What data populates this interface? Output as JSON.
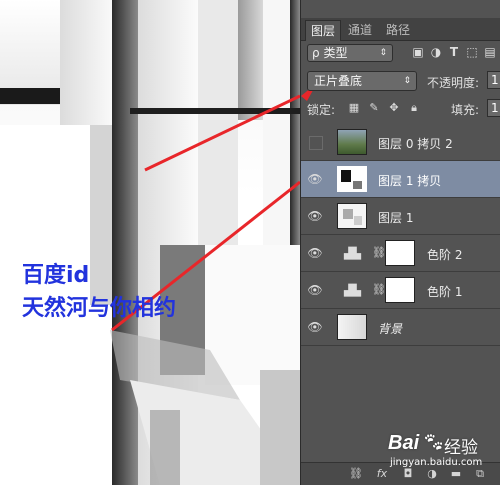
{
  "watermark": {
    "line1": "百度id",
    "line2": "天然河与你相约"
  },
  "layers_panel": {
    "tabs": [
      {
        "label": "图层",
        "active": true
      },
      {
        "label": "通道",
        "active": false
      },
      {
        "label": "路径",
        "active": false
      }
    ],
    "filter": {
      "prefix": "ρ",
      "label": "类型"
    },
    "filter_icons": [
      "image-filter-icon",
      "adjustment-filter-icon",
      "text-filter-icon",
      "shape-filter-icon"
    ],
    "blend_mode": "正片叠底",
    "opacity_label": "不透明度:",
    "opacity_value": "1",
    "lock_label": "锁定:",
    "fill_label": "填充:",
    "fill_value": "1",
    "layers": [
      {
        "name": "图层 0 拷贝 2",
        "visible": false,
        "selected": false,
        "thumb": "photo"
      },
      {
        "name": "图层 1 拷贝",
        "visible": true,
        "selected": true,
        "thumb": "mask"
      },
      {
        "name": "图层 1",
        "visible": true,
        "selected": false,
        "thumb": "mask-light"
      },
      {
        "name": "色阶 2",
        "visible": true,
        "selected": false,
        "thumb": "adjustment"
      },
      {
        "name": "色阶 1",
        "visible": true,
        "selected": false,
        "thumb": "adjustment"
      },
      {
        "name": "背景",
        "visible": true,
        "selected": false,
        "thumb": "background"
      }
    ],
    "bottom_icons": [
      "link-icon",
      "fx-icon",
      "mask-icon",
      "adjustment-icon",
      "folder-icon",
      "new-layer-icon"
    ]
  },
  "brand": {
    "logo_text": "Bai",
    "logo_suffix": "经验",
    "url": "jingyan.baidu.com"
  },
  "colors": {
    "panel_bg": "#535353",
    "selected_layer": "#7e8ca3",
    "watermark": "#2233dd",
    "arrow": "#e8262a"
  }
}
